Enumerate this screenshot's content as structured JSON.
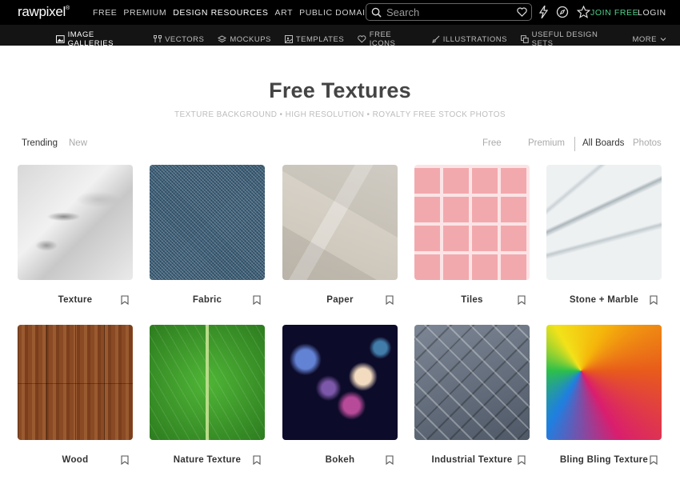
{
  "app": {
    "logo": "rawpixel",
    "logo_mark": "®"
  },
  "topnav": [
    "FREE",
    "PREMIUM",
    "DESIGN RESOURCES",
    "ART",
    "PUBLIC DOMAIN"
  ],
  "search": {
    "placeholder": "Search"
  },
  "auth": {
    "join": "JOIN FREE",
    "login": "LOGIN"
  },
  "subnav": [
    {
      "label": "IMAGE GALLERIES",
      "icon": "image-icon"
    },
    {
      "label": "VECTORS",
      "icon": "vector-icon"
    },
    {
      "label": "MOCKUPS",
      "icon": "layers-icon"
    },
    {
      "label": "TEMPLATES",
      "icon": "template-icon"
    },
    {
      "label": "FREE ICONS",
      "icon": "heart-icon"
    },
    {
      "label": "ILLUSTRATIONS",
      "icon": "brush-icon"
    },
    {
      "label": "USEFUL DESIGN SETS",
      "icon": "copy-icon"
    },
    {
      "label": "MORE",
      "icon": "chevron-down-icon"
    }
  ],
  "header": {
    "title": "Free Textures",
    "subtitle": "TEXTURE BACKGROUND • HIGH RESOLUTION • ROYALTY FREE STOCK PHOTOS"
  },
  "filters": {
    "trending": "Trending",
    "new": "New",
    "free": "Free",
    "premium": "Premium",
    "all_boards": "All Boards",
    "photos": "Photos"
  },
  "boards": [
    {
      "label": "Texture"
    },
    {
      "label": "Fabric"
    },
    {
      "label": "Paper"
    },
    {
      "label": "Tiles"
    },
    {
      "label": "Stone + Marble"
    },
    {
      "label": "Wood"
    },
    {
      "label": "Nature Texture"
    },
    {
      "label": "Bokeh"
    },
    {
      "label": "Industrial Texture"
    },
    {
      "label": "Bling Bling Texture"
    }
  ],
  "colors": {
    "topbar": "#000000",
    "subbar": "#141414",
    "join_accent": "#4fd08a"
  }
}
